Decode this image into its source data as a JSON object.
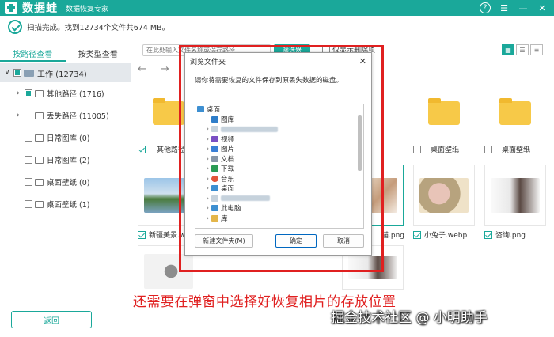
{
  "titlebar": {
    "logo_text": "数据蛙",
    "subtitle": "数据恢复专家",
    "help_icon": "help-icon",
    "menu_icon": "menu-icon",
    "minimize_icon": "minimize-icon",
    "close_icon": "close-icon",
    "brand_color": "#1aa89a"
  },
  "status": {
    "text": "扫描完成。找到12734个文件共674 MB。"
  },
  "sidebar": {
    "tabs": [
      {
        "label": "按路径查看",
        "active": true
      },
      {
        "label": "按类型查看",
        "active": false
      }
    ],
    "root": {
      "label": "工作 (12734)"
    },
    "items": [
      {
        "label": "其他路径 (1716)",
        "expandable": true,
        "state": "partial"
      },
      {
        "label": "丢失路径 (11005)",
        "expandable": true,
        "state": "none"
      },
      {
        "label": "日常图库 (0)",
        "expandable": false,
        "state": "none"
      },
      {
        "label": "日常图库 (2)",
        "expandable": false,
        "state": "none"
      },
      {
        "label": "桌面壁纸 (0)",
        "expandable": false,
        "state": "none"
      },
      {
        "label": "桌面壁纸 (1)",
        "expandable": false,
        "state": "none"
      }
    ],
    "back_label": "返回"
  },
  "toolbar": {
    "search_placeholder": "在此处输入文件名称或保存路径",
    "filter_label": "筛选器",
    "only_deleted_label": "仅显示删除项"
  },
  "grid": {
    "row1": [
      {
        "caption": "其他路径",
        "checked": true
      },
      {
        "caption": "桌面壁纸",
        "checked": false
      },
      {
        "caption": "桌面壁纸",
        "checked": false
      }
    ],
    "row2": [
      {
        "caption": "新疆美景.we",
        "checked": true
      },
      {
        "caption": "猫.png",
        "checked": true
      },
      {
        "caption": "小兔子.webp",
        "checked": true
      },
      {
        "caption": "咨询.png",
        "checked": true
      }
    ]
  },
  "dialog": {
    "title": "浏览文件夹",
    "message": "请你将需要恢复的文件保存到原丢失数据的磁盘。",
    "tree": [
      {
        "label": "桌面",
        "level": 0,
        "caret": "",
        "icon_color": "#3d8fd1"
      },
      {
        "label": "图库",
        "level": 1,
        "caret": "",
        "icon_color": "#2e7dc9"
      },
      {
        "label": "",
        "level": 1,
        "caret": "›",
        "icon_color": "#c6d2dc",
        "blurred": true
      },
      {
        "label": "视频",
        "level": 1,
        "caret": "›",
        "icon_color": "#7a4fc4"
      },
      {
        "label": "图片",
        "level": 1,
        "caret": "›",
        "icon_color": "#3a7fd6"
      },
      {
        "label": "文档",
        "level": 1,
        "caret": "›",
        "icon_color": "#8897a8"
      },
      {
        "label": "下载",
        "level": 1,
        "caret": "›",
        "icon_color": "#2a9b55"
      },
      {
        "label": "音乐",
        "level": 1,
        "caret": "›",
        "icon_color": "#e2553a"
      },
      {
        "label": "桌面",
        "level": 1,
        "caret": "›",
        "icon_color": "#3d8fd1"
      },
      {
        "label": "",
        "level": 1,
        "caret": "›",
        "icon_color": "#c6d2dc",
        "blurred": true
      },
      {
        "label": "此电脑",
        "level": 1,
        "caret": "›",
        "icon_color": "#3d8fd1"
      },
      {
        "label": "库",
        "level": 1,
        "caret": "›",
        "icon_color": "#e4b64a"
      }
    ],
    "new_folder_label": "新建文件夹(M)",
    "ok_label": "确定",
    "cancel_label": "取消"
  },
  "annotation": {
    "text": "还需要在弹窗中选择好恢复相片的存放位置",
    "color": "#e02020"
  },
  "watermark": {
    "text": "掘金技术社区 @ 小明助手"
  }
}
